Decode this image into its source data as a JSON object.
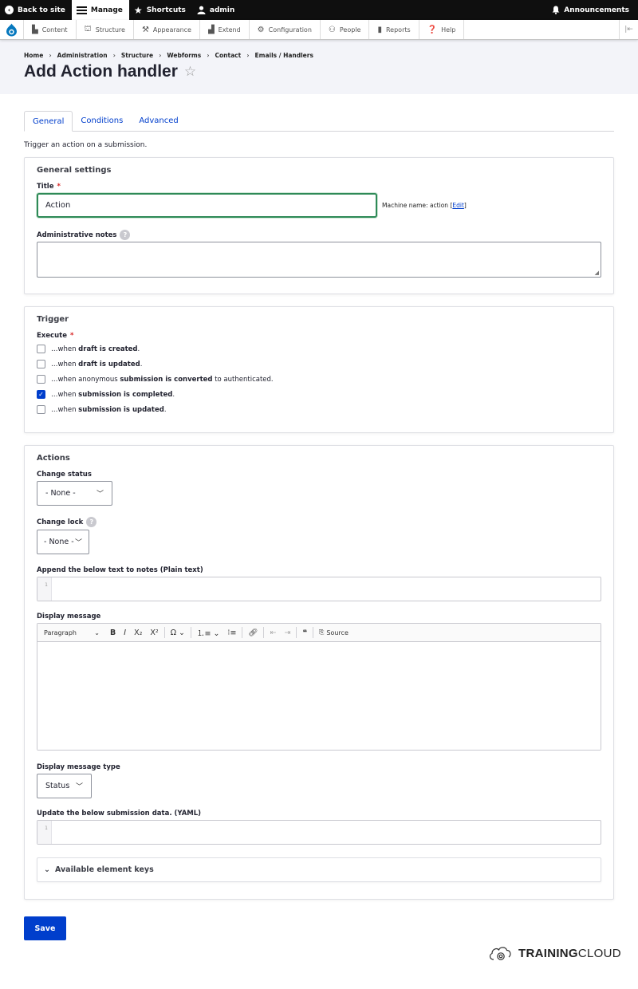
{
  "toolbar": {
    "back_to_site": "Back to site",
    "manage": "Manage",
    "shortcuts": "Shortcuts",
    "user": "admin",
    "announcements": "Announcements"
  },
  "admin_menu": {
    "items": [
      "Content",
      "Structure",
      "Appearance",
      "Extend",
      "Configuration",
      "People",
      "Reports",
      "Help"
    ]
  },
  "breadcrumb": [
    "Home",
    "Administration",
    "Structure",
    "Webforms",
    "Contact",
    "Emails / Handlers"
  ],
  "page_title": "Add Action handler",
  "tabs": [
    "General",
    "Conditions",
    "Advanced"
  ],
  "description": "Trigger an action on a submission.",
  "general_settings": {
    "heading": "General settings",
    "title_label": "Title",
    "title_value": "Action",
    "machine_name_prefix": "Machine name: action [",
    "machine_name_edit": "Edit",
    "machine_name_suffix": "]",
    "notes_label": "Administrative notes"
  },
  "trigger": {
    "heading": "Trigger",
    "execute_label": "Execute",
    "options": [
      {
        "pre": "…when ",
        "bold": "draft is created",
        "post": ".",
        "checked": false
      },
      {
        "pre": "…when ",
        "bold": "draft is updated",
        "post": ".",
        "checked": false
      },
      {
        "pre": "…when anonymous ",
        "bold": "submission is converted",
        "post": " to authenticated.",
        "checked": false
      },
      {
        "pre": "…when ",
        "bold": "submission is completed",
        "post": ".",
        "checked": true
      },
      {
        "pre": "…when ",
        "bold": "submission is updated",
        "post": ".",
        "checked": false
      }
    ]
  },
  "actions": {
    "heading": "Actions",
    "change_status_label": "Change status",
    "change_status_value": "- None -",
    "change_lock_label": "Change lock",
    "change_lock_value": "- None -",
    "notes_append_label": "Append the below text to notes (Plain text)",
    "line_number": "1",
    "display_message_label": "Display message",
    "editor": {
      "paragraph": "Paragraph",
      "source": "Source"
    },
    "message_type_label": "Display message type",
    "message_type_value": "Status",
    "update_data_label": "Update the below submission data. (YAML)",
    "available_keys": "Available element keys"
  },
  "save_label": "Save",
  "brand": {
    "bold": "TRAINING",
    "rest": "CLOUD"
  },
  "colors": {
    "primary": "#003ecc",
    "focus": "#2e8a57",
    "required": "#d72222"
  }
}
